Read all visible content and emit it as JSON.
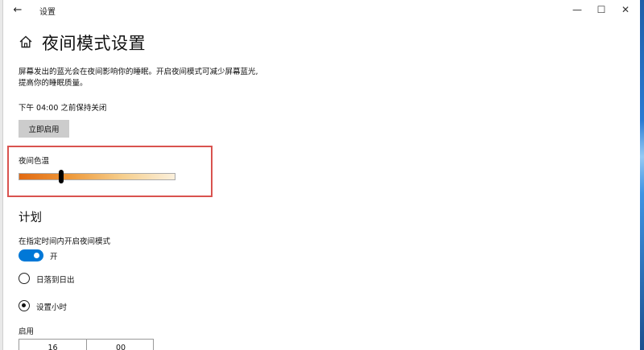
{
  "titlebar": {
    "back": "←",
    "title": "设置",
    "minimize": "—",
    "maximize": "☐",
    "close": "✕"
  },
  "page": {
    "title": "夜间模式设置",
    "description_line1": "屏幕发出的蓝光会在夜间影响你的睡眠。开启夜间模式可减少屏幕蓝光,",
    "description_line2": "提高你的睡眠质量。",
    "status": "下午 04:00 之前保持关闭",
    "enable_now_label": "立即启用"
  },
  "color_temp": {
    "label": "夜间色温",
    "value_fraction": 0.27,
    "gradient": [
      "#e26a12",
      "#ee9a3c",
      "#f6cf8e",
      "#fbf0dc"
    ]
  },
  "schedule": {
    "section_title": "计划",
    "toggle_label": "在指定时间内开启夜间模式",
    "toggle_state_text": "开",
    "toggle_on": true,
    "option_sunset": "日落到日出",
    "option_custom": "设置小时",
    "selected_option": "custom",
    "start_label": "启用",
    "start_hour": "16",
    "start_minute": "00"
  },
  "colors": {
    "accent": "#0078d7",
    "highlight": "#d9534f",
    "button_bg": "#cccccc"
  }
}
